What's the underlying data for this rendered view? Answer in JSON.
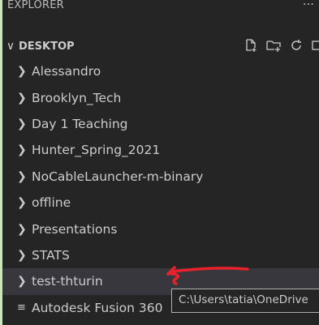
{
  "explorer": {
    "title": "EXPLORER",
    "more_label": "···"
  },
  "section": {
    "name": "DESKTOP",
    "actions": [
      "new-file-icon",
      "new-folder-icon",
      "refresh-icon"
    ]
  },
  "tree": {
    "folders": [
      "Alessandro",
      "Brooklyn_Tech",
      "Day 1 Teaching",
      "Hunter_Spring_2021",
      "NoCableLauncher-m-binary",
      "offline",
      "Presentations",
      "STATS",
      "test-thturin"
    ],
    "file": "Autodesk Fusion 360"
  },
  "tooltip": {
    "text": "C:\\Users\\tatia\\OneDrive"
  },
  "colors": {
    "panel": "#252526",
    "selected_row": "#37373d",
    "text": "#cccccc",
    "annotation_arrow": "#e8212b",
    "outer_border": "#c8e6c0"
  }
}
